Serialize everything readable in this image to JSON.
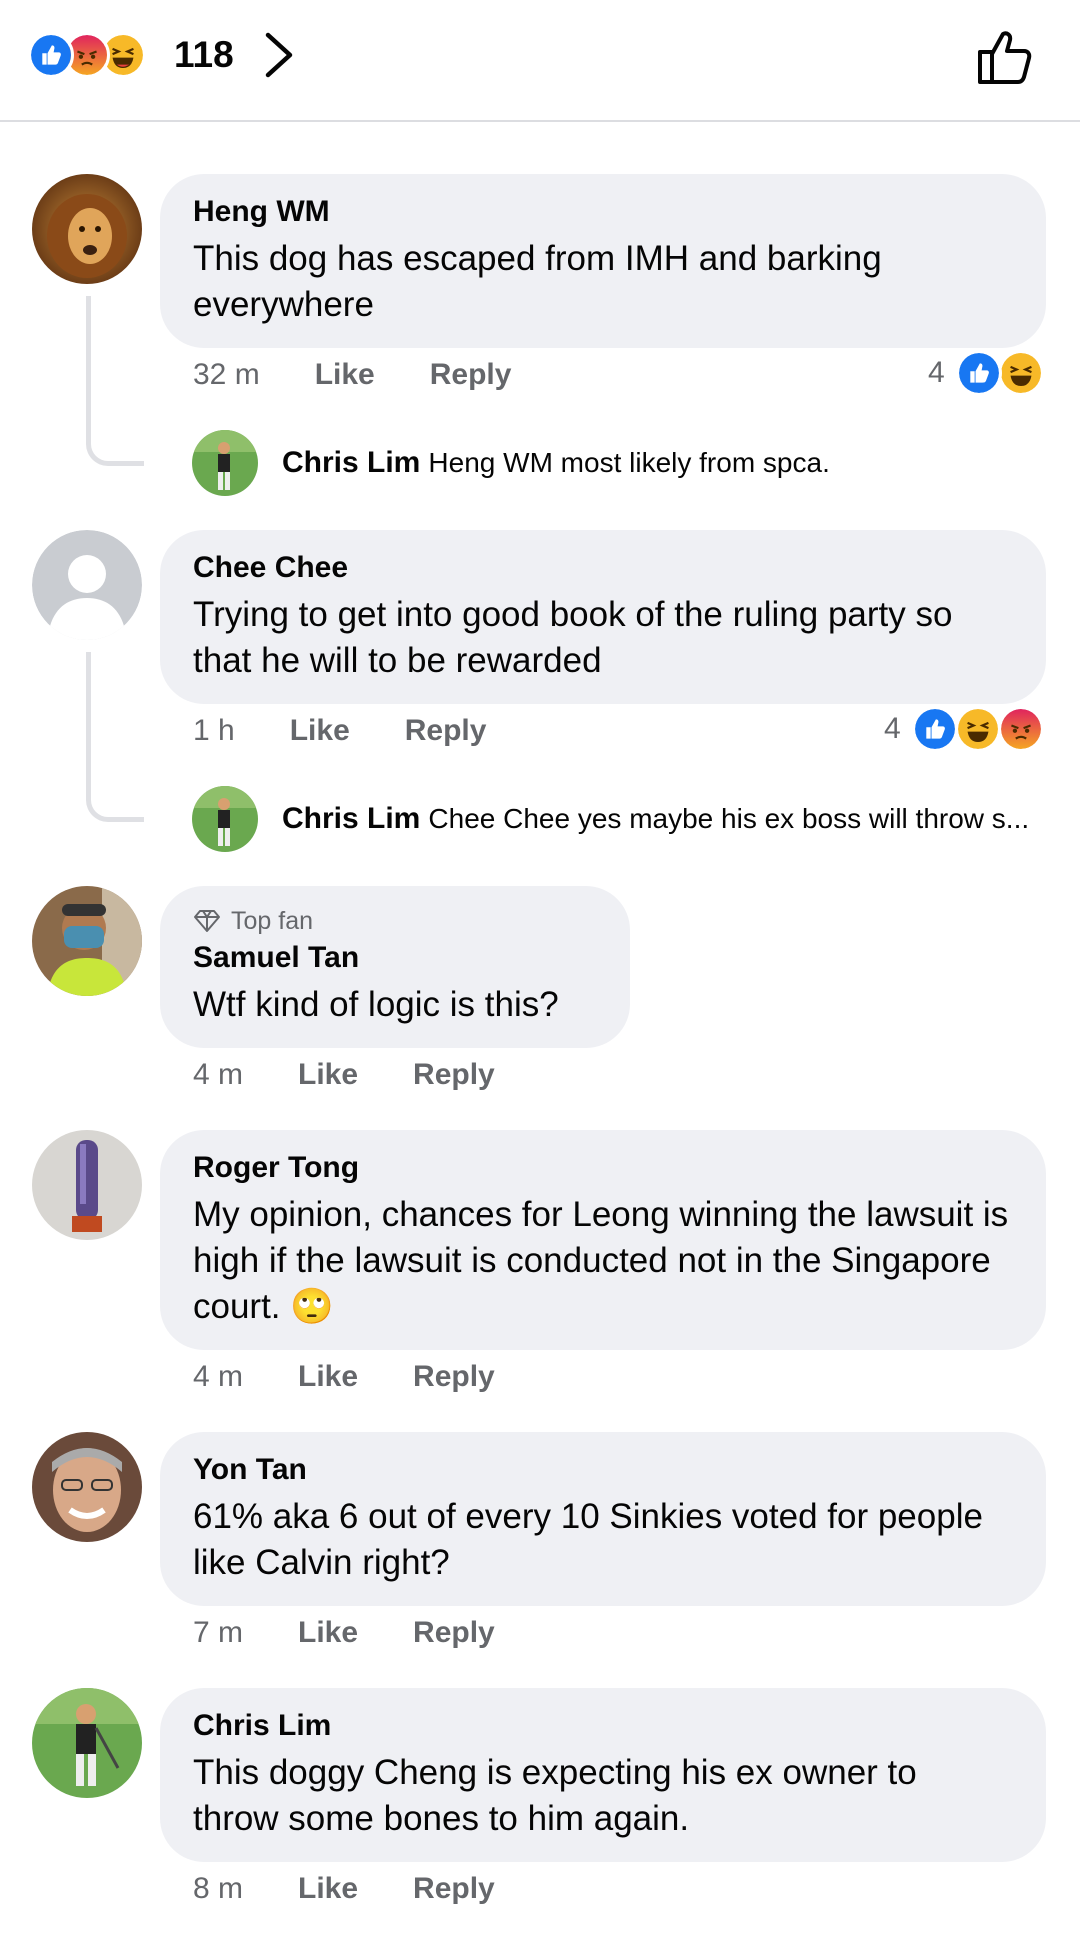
{
  "header": {
    "reaction_count": "118",
    "reactions": [
      "like",
      "angry",
      "haha"
    ]
  },
  "comments": [
    {
      "name": "Heng WM",
      "text": "This dog has escaped from IMH and barking everywhere",
      "time": "32 m",
      "like_label": "Like",
      "reply_label": "Reply",
      "reaction_count": "4",
      "reactions": [
        "like",
        "haha"
      ],
      "reply": {
        "name": "Chris Lim",
        "text": "Heng WM most likely from spca."
      }
    },
    {
      "name": "Chee Chee",
      "text": "Trying to get into good book of the ruling party so that he will to be rewarded",
      "time": "1 h",
      "like_label": "Like",
      "reply_label": "Reply",
      "reaction_count": "4",
      "reactions": [
        "like",
        "haha",
        "angry"
      ],
      "reply": {
        "name": "Chris Lim",
        "text": "Chee Chee yes maybe his ex boss will throw s..."
      }
    },
    {
      "badge": "Top fan",
      "name": "Samuel Tan",
      "text": "Wtf kind of logic is this?",
      "time": "4 m",
      "like_label": "Like",
      "reply_label": "Reply"
    },
    {
      "name": "Roger Tong",
      "text": "My opinion, chances for Leong winning the lawsuit is high if the lawsuit is conducted not in the Singapore court. 🙄",
      "time": "4 m",
      "like_label": "Like",
      "reply_label": "Reply"
    },
    {
      "name": "Yon Tan",
      "text": "61% aka 6 out of every 10 Sinkies voted for people like Calvin right?",
      "time": "7 m",
      "like_label": "Like",
      "reply_label": "Reply"
    },
    {
      "name": "Chris Lim",
      "text": "This doggy Cheng is expecting his ex owner to throw some bones to him again.",
      "time": "8 m",
      "like_label": "Like",
      "reply_label": "Reply"
    }
  ],
  "colors": {
    "like_blue": "#1877f2",
    "haha_yellow": "#f7b928",
    "angry_red": "#e9710f",
    "bubble": "#eff0f4",
    "meta_gray": "#65676b"
  }
}
